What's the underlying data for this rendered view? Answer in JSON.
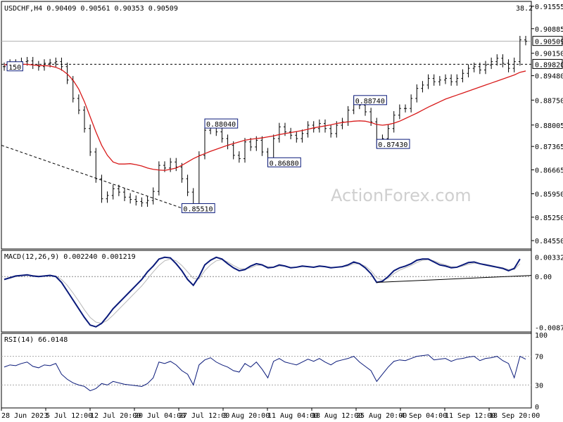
{
  "chart_data": [
    {
      "type": "candlestick",
      "symbol_header": "USDCHF,H4",
      "ohlc_header": "0.90409 0.90561 0.90353 0.90509",
      "fib_level_label": "38.2",
      "ylim": [
        0.843,
        0.917
      ],
      "y_ticks": [
        "0.91555",
        "0.90885",
        "0.90150",
        "0.89480",
        "0.88750",
        "0.88005",
        "0.87365",
        "0.86665",
        "0.85950",
        "0.85250",
        "0.84550"
      ],
      "current_price_label": "0.90509",
      "resistance_label": "0.89820",
      "annotations": [
        {
          "label": "150",
          "x": 0.5,
          "y": 0.8975
        },
        {
          "label": "0.88040",
          "x": 35,
          "y": 0.8804
        },
        {
          "label": "0.86880",
          "x": 46,
          "y": 0.8688
        },
        {
          "label": "0.85510",
          "x": 31,
          "y": 0.8551
        },
        {
          "label": "0.88740",
          "x": 61,
          "y": 0.8874
        },
        {
          "label": "0.87430",
          "x": 65,
          "y": 0.8743
        }
      ],
      "watermark": "ActionForex.com",
      "series": [
        {
          "kind": "close",
          "values": [
            0.8975,
            0.8985,
            0.8978,
            0.899,
            0.8992,
            0.898,
            0.8975,
            0.8985,
            0.8986,
            0.899,
            0.8975,
            0.8935,
            0.888,
            0.8845,
            0.879,
            0.872,
            0.864,
            0.858,
            0.859,
            0.861,
            0.86,
            0.8585,
            0.8578,
            0.8572,
            0.8568,
            0.8575,
            0.8602,
            0.868,
            0.8672,
            0.869,
            0.8675,
            0.864,
            0.86,
            0.8565,
            0.871,
            0.8785,
            0.8804,
            0.878,
            0.876,
            0.874,
            0.871,
            0.87,
            0.875,
            0.8735,
            0.8755,
            0.872,
            0.8688,
            0.876,
            0.8795,
            0.878,
            0.877,
            0.876,
            0.8775,
            0.88,
            0.879,
            0.8805,
            0.879,
            0.8775,
            0.88,
            0.881,
            0.8845,
            0.8874,
            0.886,
            0.884,
            0.881,
            0.8743,
            0.876,
            0.879,
            0.883,
            0.885,
            0.885,
            0.888,
            0.891,
            0.892,
            0.894,
            0.893,
            0.8935,
            0.894,
            0.893,
            0.894,
            0.8955,
            0.897,
            0.8975,
            0.8965,
            0.898,
            0.899,
            0.9,
            0.8985,
            0.897,
            0.899,
            0.9055,
            0.9051
          ]
        },
        {
          "kind": "ma",
          "values": [
            0.898,
            0.8981,
            0.8981,
            0.8982,
            0.8982,
            0.898,
            0.8978,
            0.8978,
            0.8977,
            0.8973,
            0.8966,
            0.8953,
            0.8935,
            0.8908,
            0.887,
            0.8825,
            0.878,
            0.874,
            0.871,
            0.869,
            0.8684,
            0.8684,
            0.8685,
            0.8682,
            0.8678,
            0.8672,
            0.8668,
            0.8666,
            0.8665,
            0.8668,
            0.8672,
            0.868,
            0.869,
            0.87,
            0.8708,
            0.8715,
            0.8722,
            0.8728,
            0.8734,
            0.874,
            0.8745,
            0.875,
            0.8755,
            0.8758,
            0.876,
            0.8762,
            0.8765,
            0.8768,
            0.8772,
            0.8775,
            0.8778,
            0.8781,
            0.8784,
            0.8788,
            0.8792,
            0.8795,
            0.8798,
            0.8801,
            0.8805,
            0.8808,
            0.881,
            0.8812,
            0.8813,
            0.8812,
            0.8808,
            0.8802,
            0.88,
            0.8802,
            0.8806,
            0.8812,
            0.882,
            0.8828,
            0.8836,
            0.8845,
            0.8854,
            0.8862,
            0.887,
            0.8878,
            0.8884,
            0.889,
            0.8896,
            0.8902,
            0.8908,
            0.8914,
            0.892,
            0.8926,
            0.8932,
            0.8938,
            0.8944,
            0.895,
            0.8958,
            0.8962
          ]
        }
      ]
    },
    {
      "type": "line",
      "label": "MACD(12,26,9) 0.002240 0.001219",
      "ylim": [
        -0.009,
        0.004
      ],
      "y_ticks": [
        "0.003328",
        "0.00",
        "-0.008707"
      ],
      "series": [
        {
          "kind": "macd",
          "values": [
            -0.0005,
            -0.0002,
            0.0001,
            0.0002,
            0.0003,
            0.0001,
            0.0,
            0.0001,
            0.0002,
            0.0,
            -0.001,
            -0.0025,
            -0.004,
            -0.0055,
            -0.007,
            -0.0083,
            -0.0086,
            -0.008,
            -0.0068,
            -0.0055,
            -0.0045,
            -0.0035,
            -0.0025,
            -0.0015,
            -0.0005,
            0.0008,
            0.0018,
            0.003,
            0.0033,
            0.0032,
            0.0022,
            0.001,
            -0.0005,
            -0.0015,
            0.0,
            0.002,
            0.0028,
            0.0033,
            0.003,
            0.0022,
            0.0015,
            0.001,
            0.0012,
            0.0018,
            0.0022,
            0.002,
            0.0015,
            0.0016,
            0.002,
            0.0018,
            0.0015,
            0.0016,
            0.0018,
            0.0017,
            0.0016,
            0.0018,
            0.0017,
            0.0015,
            0.0016,
            0.0017,
            0.002,
            0.0025,
            0.0022,
            0.0015,
            0.0005,
            -0.001,
            -0.0008,
            0.0,
            0.001,
            0.0015,
            0.0018,
            0.0022,
            0.0028,
            0.003,
            0.003,
            0.0025,
            0.002,
            0.0018,
            0.0015,
            0.0016,
            0.002,
            0.0024,
            0.0025,
            0.0022,
            0.002,
            0.0018,
            0.0016,
            0.0014,
            0.001,
            0.0014,
            0.003
          ]
        },
        {
          "kind": "signal",
          "values": [
            -0.0004,
            -0.0003,
            0.0,
            0.0001,
            0.0002,
            0.0002,
            0.0001,
            0.0001,
            0.0001,
            0.0001,
            -0.0005,
            -0.0015,
            -0.0028,
            -0.0042,
            -0.0057,
            -0.007,
            -0.0078,
            -0.008,
            -0.0075,
            -0.0066,
            -0.0056,
            -0.0046,
            -0.0036,
            -0.0026,
            -0.0016,
            -0.0004,
            0.0008,
            0.0019,
            0.0027,
            0.003,
            0.0027,
            0.0019,
            0.0008,
            -0.0003,
            -0.0004,
            0.001,
            0.002,
            0.0027,
            0.0029,
            0.0025,
            0.0019,
            0.0014,
            0.0013,
            0.0015,
            0.0019,
            0.002,
            0.0017,
            0.0016,
            0.0018,
            0.0018,
            0.0016,
            0.0016,
            0.0017,
            0.0017,
            0.0016,
            0.0017,
            0.0017,
            0.0016,
            0.0016,
            0.0017,
            0.0018,
            0.0022,
            0.0022,
            0.0018,
            0.001,
            -0.0002,
            -0.0006,
            -0.0003,
            0.0005,
            0.0011,
            0.0015,
            0.0019,
            0.0024,
            0.0028,
            0.0029,
            0.0027,
            0.0023,
            0.002,
            0.0017,
            0.0016,
            0.0018,
            0.0021,
            0.0023,
            0.0022,
            0.0021,
            0.0019,
            0.0017,
            0.0015,
            0.0012,
            0.0012,
            0.0022
          ]
        }
      ]
    },
    {
      "type": "line",
      "label": "RSI(14) 66.0148",
      "ylim": [
        0,
        100
      ],
      "y_ticks": [
        "100",
        "70",
        "30",
        "0"
      ],
      "series": [
        {
          "kind": "rsi",
          "values": [
            55,
            58,
            57,
            60,
            62,
            56,
            54,
            58,
            57,
            60,
            45,
            38,
            33,
            30,
            28,
            22,
            25,
            32,
            30,
            35,
            33,
            31,
            30,
            29,
            28,
            32,
            40,
            62,
            60,
            63,
            58,
            50,
            45,
            30,
            58,
            65,
            68,
            62,
            58,
            55,
            50,
            48,
            60,
            55,
            62,
            52,
            40,
            63,
            67,
            62,
            60,
            58,
            62,
            66,
            63,
            67,
            62,
            58,
            63,
            65,
            67,
            70,
            62,
            56,
            50,
            35,
            45,
            55,
            63,
            65,
            64,
            67,
            70,
            71,
            72,
            65,
            66,
            67,
            63,
            66,
            67,
            69,
            70,
            64,
            67,
            68,
            70,
            64,
            60,
            40,
            70,
            66
          ]
        }
      ]
    }
  ],
  "x_axis_labels": [
    "28 Jun 2023",
    "5 Jul 12:00",
    "12 Jul 20:00",
    "20 Jul 04:00",
    "27 Jul 12:00",
    "3 Aug 20:00",
    "11 Aug 04:00",
    "18 Aug 12:00",
    "25 Aug 20:00",
    "4 Sep 04:00",
    "11 Sep 12:00",
    "18 Sep 20:00"
  ]
}
